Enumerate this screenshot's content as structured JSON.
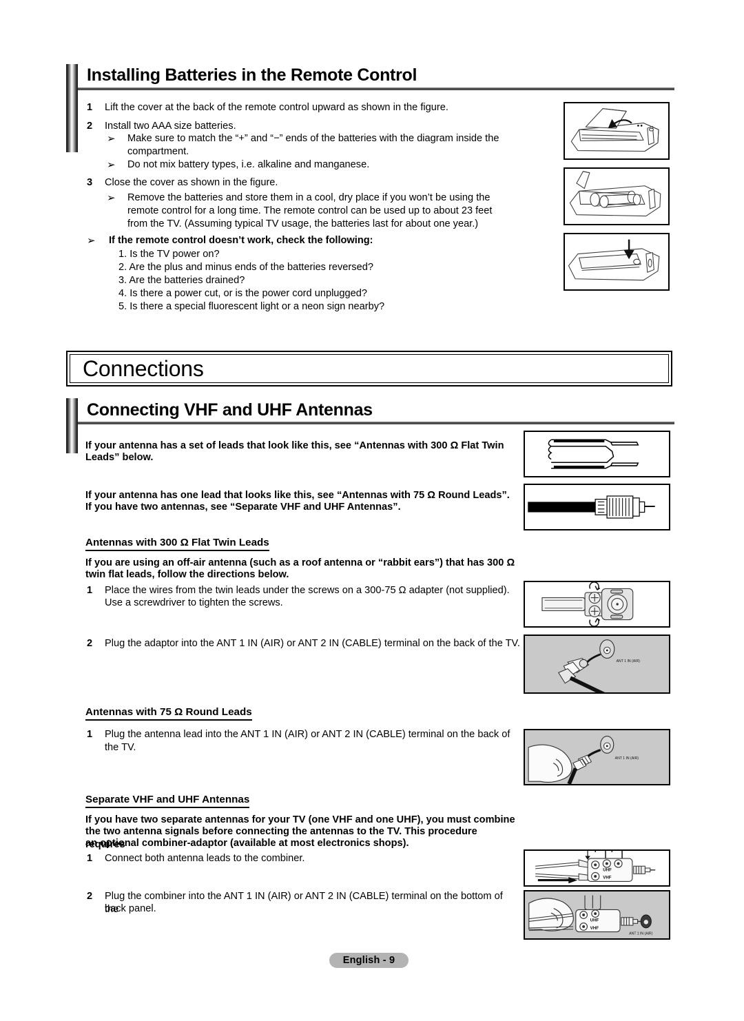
{
  "document": {
    "footer_label": "English - 9"
  },
  "section1": {
    "heading": "Installing Batteries in the Remote Control",
    "steps": [
      {
        "num": "1",
        "text": "Lift the cover at the back of the remote control upward as shown in the figure."
      },
      {
        "num": "2",
        "text": "Install two AAA size batteries."
      },
      {
        "num": "3",
        "text": "Close the cover as shown in the figure."
      }
    ],
    "bullets": {
      "b1_line1": "Make sure to match the “+” and “−” ends of the batteries with the diagram inside the",
      "b1_line2": "compartment.",
      "b2": "Do not mix battery types, i.e. alkaline and manganese.",
      "b3_line1": "Remove the batteries and store them in a cool, dry place if you won’t be using the",
      "b3_line2": "remote control for a long time. The remote control can be used up to about 23 feet",
      "b3_line3": "from the TV. (Assuming typical TV usage, the batteries last for about one year.)"
    },
    "troubleshoot": {
      "title": "If the remote control doesn’t work, check the following:",
      "items": [
        "1. Is the TV power on?",
        "2. Are the plus and minus ends of the batteries reversed?",
        "3. Are the batteries drained?",
        "4. Is there a power cut, or is the power cord unplugged?",
        "5. Is there a special fluorescent light or a neon sign nearby?"
      ]
    },
    "arrow_glyph": "➢"
  },
  "banner": {
    "title": "Connections"
  },
  "section2": {
    "heading": "Connecting VHF and UHF Antennas",
    "intro1_line1": "If your antenna has a set of leads that look like this, see “Antennas with 300 Ω Flat Twin",
    "intro1_line2": "Leads” below.",
    "intro2_line1": "If your antenna has one lead that looks like this, see “Antennas with 75 Ω Round Leads”.",
    "intro2_line2": "If you have two antennas, see “Separate VHF and UHF Antennas”.",
    "sub1": {
      "heading": "Antennas with 300 Ω Flat Twin Leads",
      "body_line1": "If you are using an off-air antenna (such as a roof antenna or “rabbit ears”) that has 300 Ω",
      "body_line2": "twin flat leads, follow the directions below.",
      "step1_num": "1",
      "step1_line1": "Place the wires from the twin leads under the screws on a 300-75 Ω adapter (not supplied).",
      "step1_line2": "Use a screwdriver to tighten the screws.",
      "step2_num": "2",
      "step2_line1": "Plug the adaptor into the ANT 1 IN (AIR) or ANT 2 IN (CABLE) terminal on the back of the TV."
    },
    "sub2": {
      "heading": "Antennas with 75 Ω Round Leads",
      "step1_num": "1",
      "step1_line1": "Plug the antenna lead into the ANT 1 IN (AIR) or ANT 2 IN (CABLE) terminal on the back of the TV."
    },
    "sub3": {
      "heading": "Separate VHF and UHF Antennas",
      "body_line1": "If you have two separate antennas for your TV (one VHF and one UHF), you must combine",
      "body_line2": "the two antenna signals before connecting the antennas to the TV. This procedure requires",
      "body_line3": "an optional combiner-adaptor (available at most electronics shops).",
      "step1_num": "1",
      "step1_line1": "Connect both antenna leads to the combiner.",
      "step2_num": "2",
      "step2_line1": "Plug the combiner into the ANT 1 IN (AIR) or ANT 2 IN (CABLE) terminal on the bottom of the",
      "step2_line2": "back panel."
    }
  },
  "figures": {
    "remote_open": "remote-control-cover-open",
    "remote_batteries": "remote-control-batteries-inserted",
    "remote_close": "remote-control-cover-close",
    "twin_lead": "flat-twin-lead-cable",
    "coax_lead": "round-coax-lead-cable",
    "adapter_screws": "300-75-ohm-adapter-screws",
    "adapter_plug": "adapter-plugged-into-terminal",
    "hand_plug": "hand-plugging-coax-into-terminal",
    "combiner": "combiner-adaptor-connections",
    "combiner_plug": "combiner-plugged-into-terminal",
    "terminal_label": "ANT 1 IN (AIR)",
    "uhf_label": "UHF",
    "vhf_label": "VHF"
  },
  "colors": {
    "figure_gray": "#c9c9c9",
    "footer_gray": "#b3b3b3",
    "rule_gray": "#4d4d4d"
  }
}
